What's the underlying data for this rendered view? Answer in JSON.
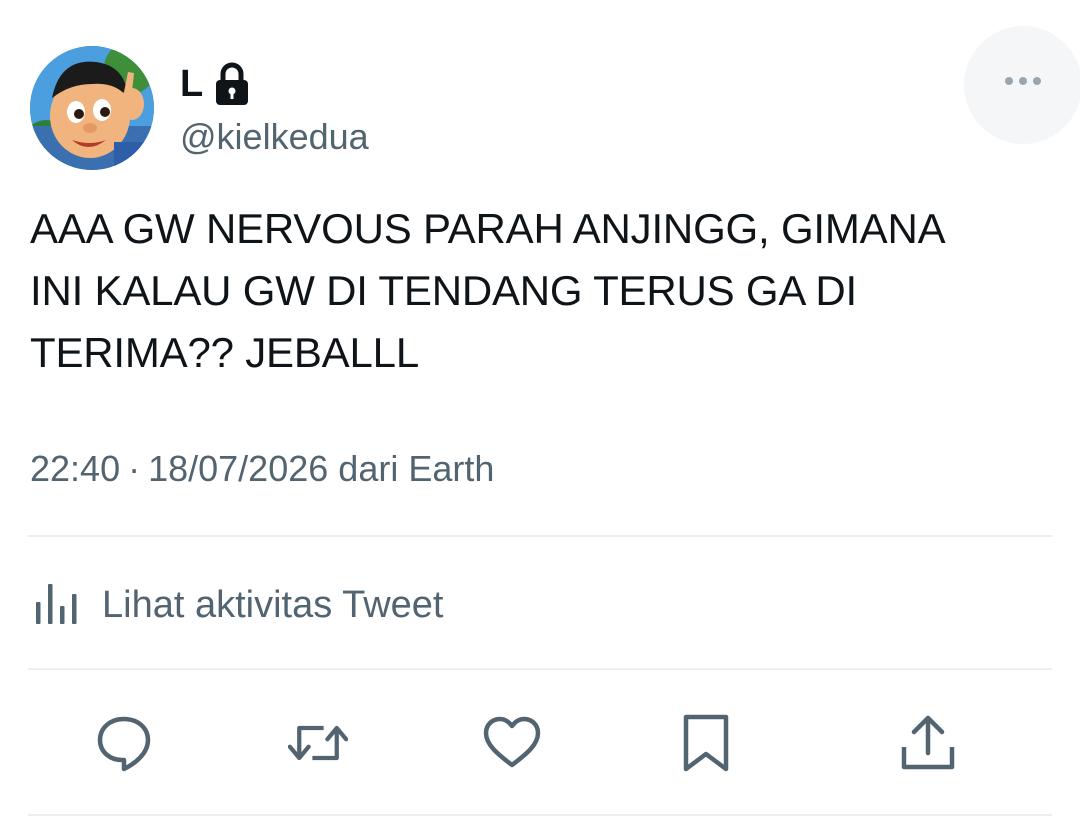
{
  "user": {
    "display_name": "L",
    "handle": "@kielkedua",
    "protected_icon": "lock-icon",
    "avatar_icon": "cartoon-boy-avatar"
  },
  "tweet": {
    "text": "AAA GW NERVOUS PARAH ANJINGG, GIMANA\nINI KALAU GW DI TENDANG TERUS GA DI\nTERIMA?? JEBALLL",
    "time": "22:40",
    "separator": "·",
    "date": "18/07/2026",
    "source": "dari Earth"
  },
  "activity": {
    "icon": "analytics-bars-icon",
    "label": "Lihat aktivitas Tweet"
  },
  "actions": [
    {
      "name": "reply",
      "icon": "comment-bubble-icon"
    },
    {
      "name": "retweet",
      "icon": "retweet-arrows-icon"
    },
    {
      "name": "like",
      "icon": "heart-icon"
    },
    {
      "name": "bookmark",
      "icon": "bookmark-icon"
    },
    {
      "name": "share",
      "icon": "share-upload-icon"
    }
  ],
  "colors": {
    "text_primary": "#0f1419",
    "text_secondary": "#536471",
    "divider": "#eceff1",
    "more_button_bg": "#f5f6f7"
  }
}
